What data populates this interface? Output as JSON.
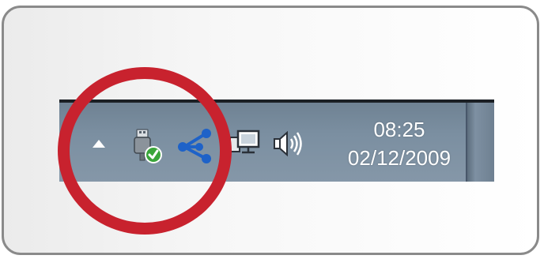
{
  "tray": {
    "icons": [
      {
        "name": "show-hidden-icons-arrow",
        "tooltip": ""
      },
      {
        "name": "safely-remove-hardware-icon"
      },
      {
        "name": "network-share-icon"
      },
      {
        "name": "network-computer-icon"
      },
      {
        "name": "volume-speaker-icon"
      }
    ],
    "time": "08:25",
    "date": "02/12/2009"
  },
  "colors": {
    "highlight_ring": "#c8222e",
    "taskbar": "#7b8fa1",
    "share_icon": "#1e62c8",
    "check_badge": "#3aa53a"
  }
}
